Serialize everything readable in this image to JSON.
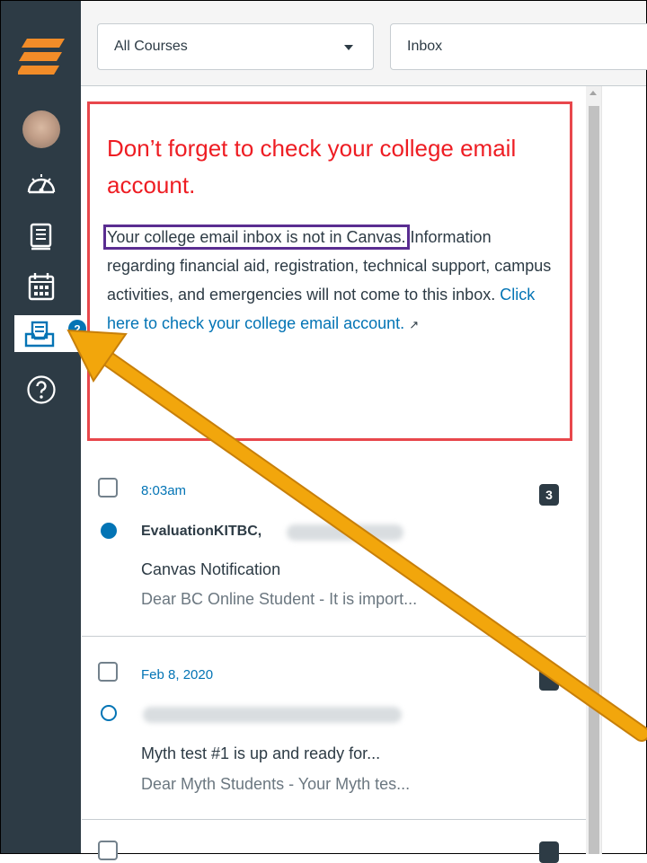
{
  "nav": {
    "logo_icon": "canvas-logo-icon",
    "items": [
      {
        "name": "account",
        "icon": "avatar"
      },
      {
        "name": "dashboard",
        "icon": "dashboard-icon"
      },
      {
        "name": "courses",
        "icon": "courses-icon"
      },
      {
        "name": "calendar",
        "icon": "calendar-icon"
      },
      {
        "name": "inbox",
        "icon": "inbox-icon",
        "badge": "2",
        "active": true
      },
      {
        "name": "help",
        "icon": "help-icon"
      }
    ]
  },
  "toolbar": {
    "course_filter": "All Courses",
    "mailbox_filter": "Inbox"
  },
  "notice": {
    "title": "Don’t forget to check your college email account.",
    "highlight": "Your college email inbox is not in Canvas.",
    "body": " Information regarding financial aid, registration, technical support, campus activities, and emergencies will not come to this inbox. ",
    "link": "Click here to check your college email account.",
    "colors": {
      "title": "#ee1d23",
      "border": "#e8474c",
      "highlight_border": "#5a2d91",
      "link": "#0374b5"
    }
  },
  "messages": [
    {
      "date": "8:03am",
      "count": "3",
      "unread": true,
      "sender": "EvaluationKITBC,",
      "subject": "Canvas Notification",
      "preview": "Dear BC Online Student - It is import..."
    },
    {
      "date": "Feb 8, 2020",
      "count": "",
      "unread": false,
      "sender": "",
      "subject": "Myth test #1 is up and ready for...",
      "preview": "Dear Myth Students - Your Myth tes..."
    },
    {
      "date": "",
      "count": "",
      "unread": false,
      "sender": "",
      "subject": "",
      "preview": ""
    }
  ],
  "annotation": {
    "arrow_color": "#f2a60c"
  }
}
